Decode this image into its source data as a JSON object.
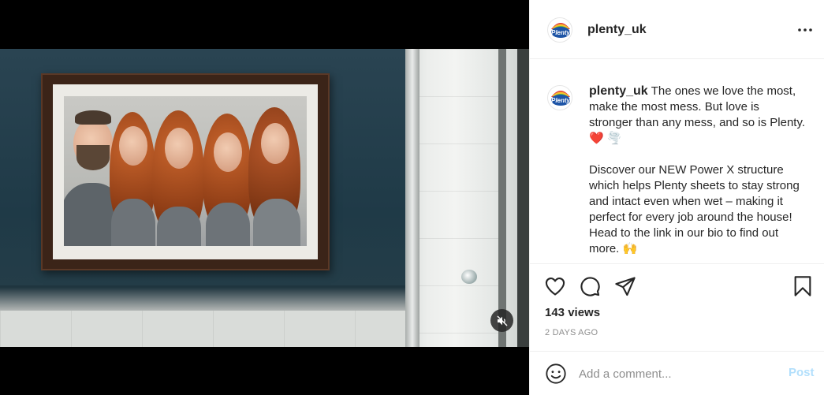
{
  "post": {
    "username": "plenty_uk",
    "avatar_text": "Plenty",
    "caption_paragraph_1": "The ones we love the most, make the most mess. But love is stronger than any mess, and so is Plenty. ❤️ 🌪️",
    "caption_paragraph_2": "Discover our NEW Power X structure which helps Plenty sheets to stay strong and intact even when wet – making it perfect for every job around the house! Head to the link in our bio to find out more. 🙌",
    "views": "143 views",
    "date": "2 DAYS AGO"
  },
  "comment": {
    "placeholder": "Add a comment...",
    "post_label": "Post"
  },
  "icons": {
    "more": "more-options-icon",
    "like": "heart-icon",
    "comment": "comment-icon",
    "share": "share-icon",
    "save": "bookmark-icon",
    "mute": "volume-muted-icon",
    "emoji": "emoji-icon"
  },
  "colors": {
    "post_button": "#b2dffc",
    "text": "#262626",
    "muted": "#8e8e8e"
  }
}
